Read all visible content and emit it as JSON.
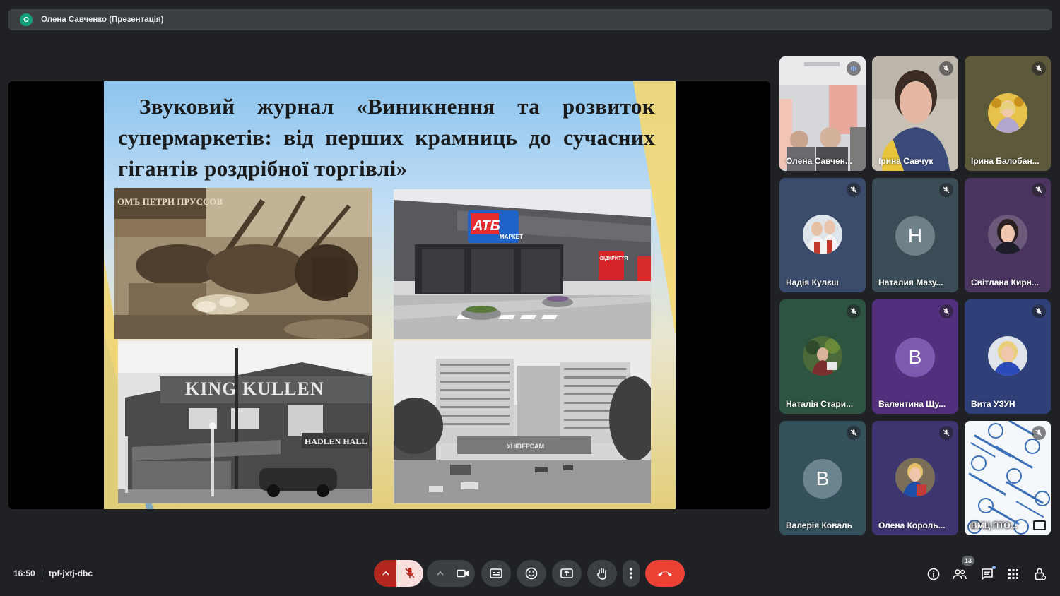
{
  "presenter_bar": {
    "avatar_letter": "О",
    "title": "Олена Савченко (Презентація)",
    "avatar_color": "#12a17a"
  },
  "slide": {
    "title": "Звуковий журнал «Виникнення та розвиток супермаркетів: від перших крамниць до сучасних гігантів роздрібної торгівлі»",
    "photos": {
      "market_sign": "ОМЪ ПЕТРИ ПРУССОВ",
      "atb_logo": "АТБ",
      "atb_sub": "МАРКЕТ",
      "atb_open": "ВІДКРИТТЯ",
      "king_kullen_sign": "KING KULLEN",
      "king_kullen_sub": "HADLEN HALL",
      "soviet_sign": "УНІВЕРСАМ"
    }
  },
  "participants": [
    {
      "name": "Олена Савчен...",
      "type": "video",
      "active": true,
      "mic": "speaking",
      "bg": "#c9ccd1"
    },
    {
      "name": "Ірина Савчук",
      "type": "video",
      "active": false,
      "mic": "muted",
      "bg": "#b7b3ad"
    },
    {
      "name": "Ірина Балобан...",
      "type": "avatar",
      "active": false,
      "mic": "muted",
      "bg": "#5d5a3c"
    },
    {
      "name": "Надія Кулєш",
      "type": "avatar",
      "active": false,
      "mic": "muted",
      "bg": "#3a4b6c"
    },
    {
      "name": "Наталия Мазу...",
      "type": "letter",
      "letter": "Н",
      "active": false,
      "mic": "muted",
      "bg": "#3a4d57",
      "circle": "#6f8188"
    },
    {
      "name": "Світлана Кирн...",
      "type": "avatar",
      "active": false,
      "mic": "muted",
      "bg": "#4a3560"
    },
    {
      "name": "Наталія Стари...",
      "type": "avatar",
      "active": false,
      "mic": "muted",
      "bg": "#2d5440"
    },
    {
      "name": "Валентина Щу...",
      "type": "letter",
      "letter": "В",
      "active": false,
      "mic": "muted",
      "bg": "#52307e",
      "circle": "#7e5bb0"
    },
    {
      "name": "Вита УЗУН",
      "type": "avatar",
      "active": false,
      "mic": "muted",
      "bg": "#2f3f78"
    },
    {
      "name": "Валерія Коваль",
      "type": "letter",
      "letter": "В",
      "active": false,
      "mic": "muted",
      "bg": "#34505b",
      "circle": "#6a8490"
    },
    {
      "name": "Олена Король...",
      "type": "avatar",
      "active": false,
      "mic": "muted",
      "bg": "#3e3670"
    },
    {
      "name": "ВМЦ ПТО...",
      "type": "logo",
      "active": false,
      "mic": "muted",
      "bg": "#ffffff"
    }
  ],
  "bottom": {
    "time": "16:50",
    "meeting_code": "tpf-jxtj-dbc",
    "participants_count": "13"
  },
  "colors": {
    "end_call": "#ea4335",
    "mic_off_bg": "#f9dedc",
    "mic_off_icon": "#b3261e",
    "bar_bg": "#3c4043"
  }
}
